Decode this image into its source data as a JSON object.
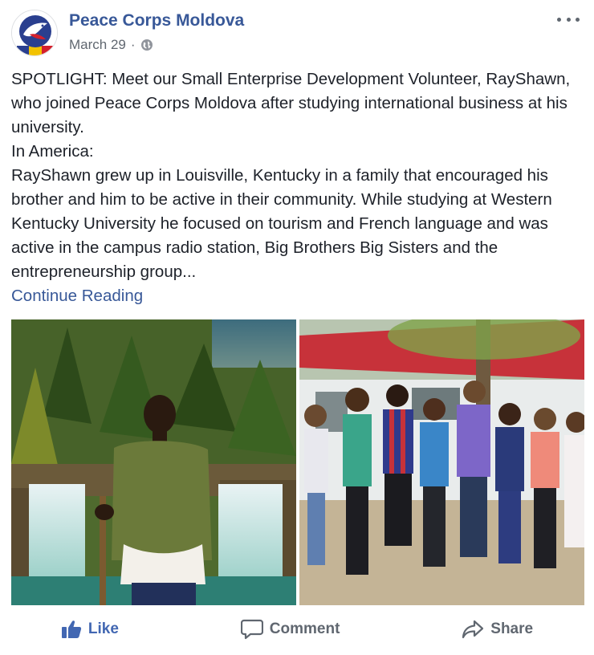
{
  "post": {
    "page_name": "Peace Corps Moldova",
    "date": "March 29",
    "separator": "·",
    "audience_icon": "globe-icon",
    "paragraphs": [
      "SPOTLIGHT: Meet our Small Enterprise Development Volunteer, RayShawn, who joined Peace Corps Moldova after studying international business at his university.",
      "In America:",
      "RayShawn grew up in Louisville, Kentucky in a family that encouraged his brother and him to be active in their community. While studying at Western Kentucky University he focused on tourism and French language and was active in the campus radio station, Big Brothers Big Sisters and the entrepreneurship group..."
    ],
    "continue_label": "Continue Reading"
  },
  "actions": {
    "like_label": "Like",
    "comment_label": "Comment",
    "share_label": "Share"
  },
  "colors": {
    "link": "#385898",
    "like_blue": "#4267b2",
    "secondary_text": "#606770"
  }
}
